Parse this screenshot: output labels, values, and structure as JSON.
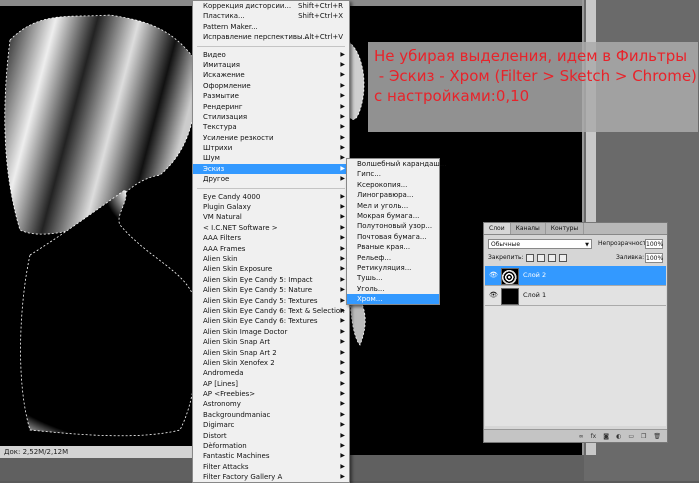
{
  "annotation": {
    "line1": "Не убирая выделения, идем в Фильтры",
    "line2": " - Эскиз - Хром (Filter > Sketch > Chrome)",
    "line3": "с настройками:0,10"
  },
  "status": {
    "doc_info": "Док: 2,52M/2,12M"
  },
  "filter_menu": {
    "top_items": [
      {
        "label": "Коррекция дисторсии...",
        "shortcut": "Shift+Ctrl+R"
      },
      {
        "label": "Пластика...",
        "shortcut": "Shift+Ctrl+X"
      },
      {
        "label": "Pattern Maker...",
        "shortcut": ""
      },
      {
        "label": "Исправление перспективы...",
        "shortcut": "Alt+Ctrl+V"
      }
    ],
    "builtin": [
      "Видео",
      "Имитация",
      "Искажение",
      "Оформление",
      "Размытие",
      "Рендеринг",
      "Стилизация",
      "Текстура",
      "Усиление резкости",
      "Штрихи",
      "Шум",
      "Эскиз",
      "Другое"
    ],
    "highlighted": "Эскиз",
    "plugins": [
      "Eye Candy 4000",
      "Plugin Galaxy",
      "VM Natural",
      "< I.C.NET Software >",
      "AAA Filters",
      "AAA Frames",
      "Alien Skin",
      "Alien Skin Exposure",
      "Alien Skin Eye Candy 5: Impact",
      "Alien Skin Eye Candy 5: Nature",
      "Alien Skin Eye Candy 5: Textures",
      "Alien Skin Eye Candy 6: Text & Selection",
      "Alien Skin Eye Candy 6: Textures",
      "Alien Skin Image Doctor",
      "Alien Skin Snap Art",
      "Alien Skin Snap Art 2",
      "Alien Skin Xenofex 2",
      "Andromeda",
      "AP [Lines]",
      "AP <Freebies>",
      "Astronomy",
      "Backgroundmaniac",
      "Digimarc",
      "Distort",
      "Dèformation",
      "Fantastic Machines",
      "Filter Attacks",
      "Filter Factory Gallery A"
    ]
  },
  "sketch_submenu": {
    "items": [
      "Волшебный карандаш...",
      "Гипс...",
      "Ксерокопия...",
      "Линогравюра...",
      "Мел и уголь...",
      "Мокрая бумага...",
      "Полутоновый узор...",
      "Почтовая бумага...",
      "Рваные края...",
      "Рельеф...",
      "Ретикуляция...",
      "Тушь...",
      "Уголь...",
      "Хром..."
    ],
    "highlighted": "Хром..."
  },
  "layers_panel": {
    "tabs": [
      "Слои",
      "Каналы",
      "Контуры"
    ],
    "blend_mode": "Обычные",
    "opacity_label": "Непрозрачность:",
    "opacity_value": "100%",
    "lock_label": "Закрепить:",
    "fill_label": "Заливка:",
    "fill_value": "100%",
    "layers": [
      {
        "name": "Слой 2",
        "selected": true
      },
      {
        "name": "Слой 1",
        "selected": false
      }
    ],
    "footer_icons": [
      "link-icon",
      "fx-icon",
      "mask-icon",
      "adjustment-icon",
      "folder-icon",
      "new-layer-icon",
      "trash-icon"
    ]
  },
  "colors": {
    "highlight": "#3399ff",
    "annotation_text": "#e8232a"
  }
}
